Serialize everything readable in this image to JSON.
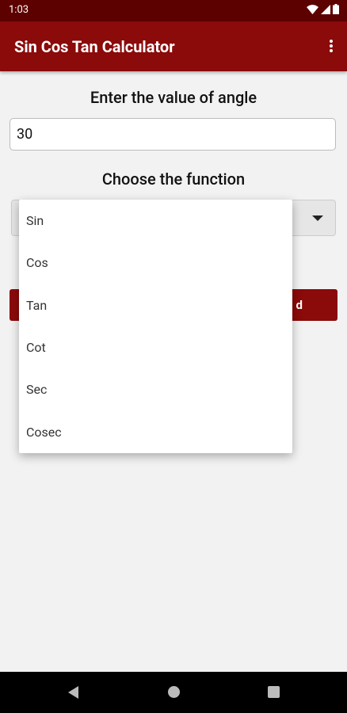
{
  "status_bar": {
    "time": "1:03"
  },
  "app_bar": {
    "title": "Sin Cos Tan Calculator"
  },
  "angle_label": "Enter the value of angle",
  "angle_input": {
    "value": "30"
  },
  "function_label": "Choose the function",
  "action_button": {
    "visible_text": "d"
  },
  "dropdown": {
    "options": [
      "Sin",
      "Cos",
      "Tan",
      "Cot",
      "Sec",
      "Cosec"
    ]
  },
  "colors": {
    "status_bar": "#5c0000",
    "primary": "#8b0a0a",
    "background": "#f2f2f2"
  }
}
